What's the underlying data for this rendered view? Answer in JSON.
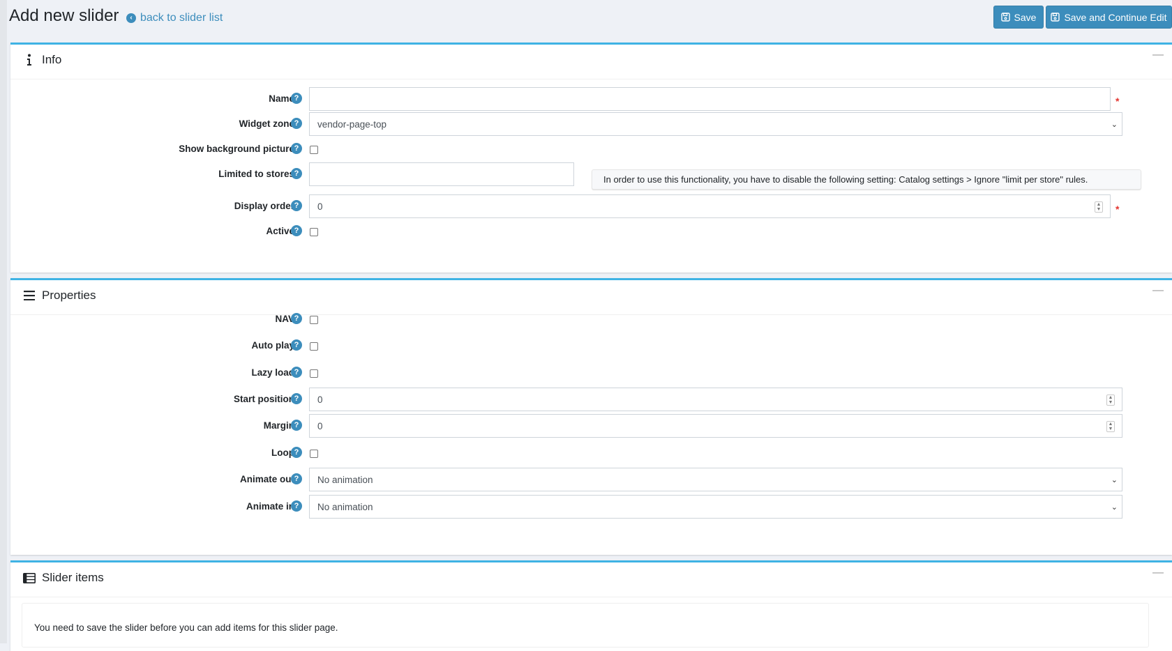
{
  "header": {
    "title": "Add new slider",
    "back_link": "back to slider list",
    "save_label": "Save",
    "save_continue_label": "Save and Continue Edit"
  },
  "info": {
    "title": "Info",
    "fields": {
      "name": {
        "label": "Name",
        "value": ""
      },
      "widget_zone": {
        "label": "Widget zone",
        "value": "vendor-page-top"
      },
      "show_bg": {
        "label": "Show background picture"
      },
      "limited_stores": {
        "label": "Limited to stores",
        "value": ""
      },
      "display_order": {
        "label": "Display order",
        "value": "0"
      },
      "active": {
        "label": "Active"
      }
    },
    "stores_note": "In order to use this functionality, you have to disable the following setting: Catalog settings > Ignore \"limit per store\" rules."
  },
  "properties": {
    "title": "Properties",
    "fields": {
      "nav": {
        "label": "NAV"
      },
      "auto_play": {
        "label": "Auto play"
      },
      "lazy_load": {
        "label": "Lazy load"
      },
      "start_position": {
        "label": "Start position",
        "value": "0"
      },
      "margin": {
        "label": "Margin",
        "value": "0"
      },
      "loop": {
        "label": "Loop"
      },
      "animate_out": {
        "label": "Animate out",
        "value": "No animation"
      },
      "animate_in": {
        "label": "Animate in",
        "value": "No animation"
      }
    }
  },
  "slider_items": {
    "title": "Slider items",
    "message": "You need to save the slider before you can add items for this slider page."
  },
  "common": {
    "help_glyph": "?",
    "required_mark": "*",
    "collapse_glyph": "—"
  },
  "colors": {
    "accent": "#3c8dbc",
    "card_border": "#3fb3e4",
    "required": "#e3342f"
  }
}
